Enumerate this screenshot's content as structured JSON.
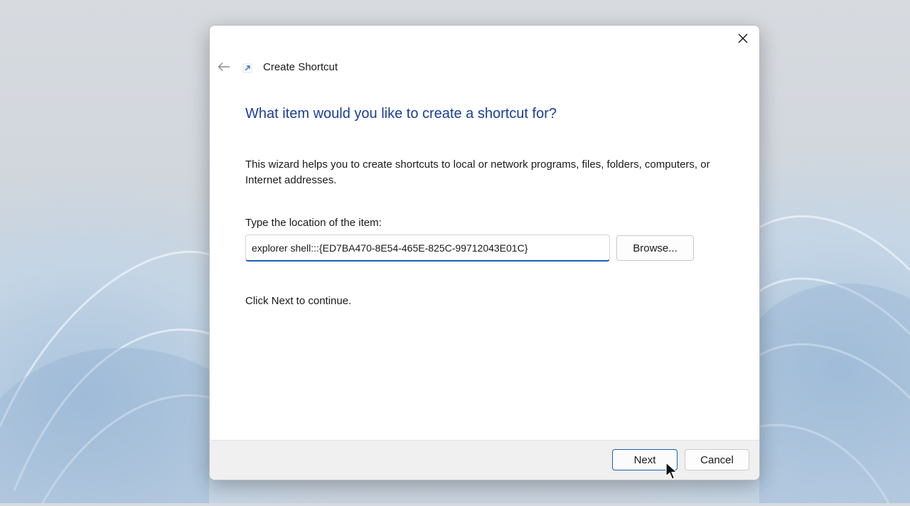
{
  "window": {
    "title": "Create Shortcut",
    "icons": {
      "back": "back-arrow-icon",
      "close": "close-icon",
      "app": "shortcut-icon"
    }
  },
  "content": {
    "heading": "What item would you like to create a shortcut for?",
    "description": "This wizard helps you to create shortcuts to local or network programs, files, folders, computers, or Internet addresses.",
    "location_label": "Type the location of the item:",
    "location_value": "explorer shell:::{ED7BA470-8E54-465E-825C-99712043E01C}",
    "browse_label": "Browse...",
    "hint": "Click Next to continue."
  },
  "footer": {
    "next_label": "Next",
    "cancel_label": "Cancel"
  },
  "colors": {
    "heading": "#1a3d99",
    "accent": "#1b5fb5"
  }
}
